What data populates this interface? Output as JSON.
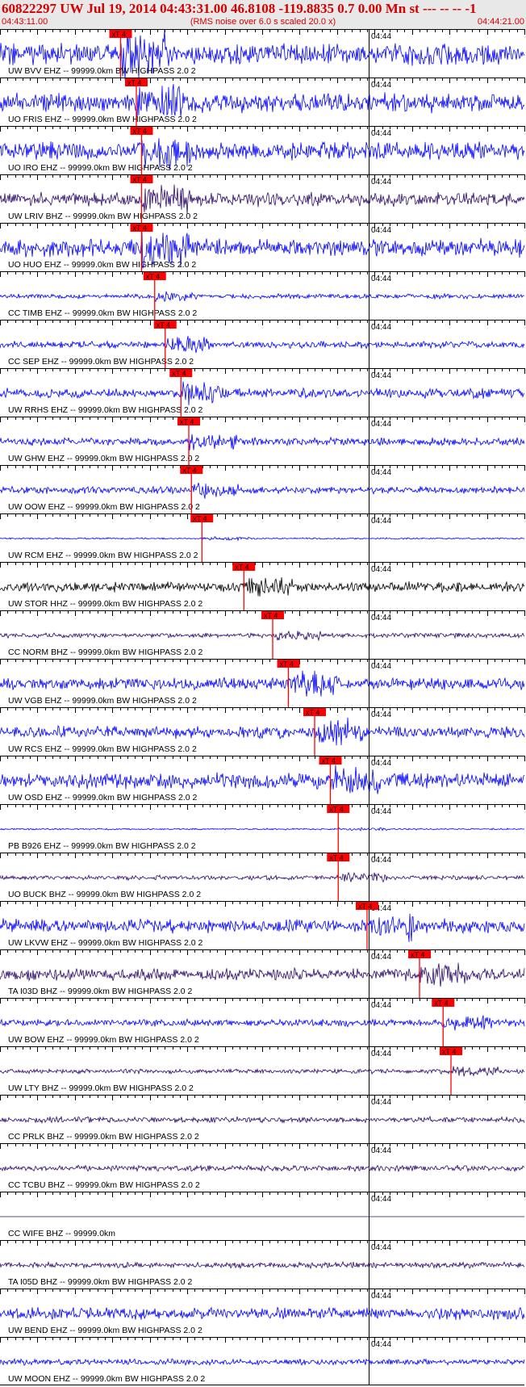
{
  "header": {
    "title": "60822297 UW Jul 19, 2014 04:43:31.00   46.8108 -119.8835  0.7 0.00 Mn st --- -- --  -1",
    "start_time": "04:43:11.00",
    "subtitle": "(RMS noise over 6.0 s scaled 20.0 x)",
    "end_time": "04:44:21.00"
  },
  "colors": {
    "trace_blue": "#0000ff",
    "trace_purple": "#2b0a6b",
    "trace_black": "#000000",
    "pick_red": "#ff0000",
    "header_bg": "#e8e8e8",
    "header_text": "#d40000"
  },
  "chart_data": {
    "type": "line",
    "x_range": [
      "04:43:11.00",
      "04:44:21.00"
    ],
    "minute_mark": "04:44",
    "pick_label": "xT 4",
    "series": [
      {
        "name": "UW BVV EHZ -- 99999.0km BW  HIGHPASS  2.0  2",
        "color": "blue",
        "amp": 0.55,
        "pick_x": 0.23
      },
      {
        "name": "UO FRIS EHZ -- 99999.0km BW  HIGHPASS  2.0  2",
        "color": "blue",
        "amp": 0.5,
        "pick_x": 0.26
      },
      {
        "name": "UO IRO EHZ -- 99999.0km BW  HIGHPASS  2.0  2",
        "color": "blue",
        "amp": 0.45,
        "pick_x": 0.27
      },
      {
        "name": "UW LRIV BHZ -- 99999.0km BW  HIGHPASS  2.0  2",
        "color": "purple",
        "amp": 0.35,
        "pick_x": 0.27
      },
      {
        "name": "UO HUO EHZ -- 99999.0km BW  HIGHPASS  2.0  2",
        "color": "blue",
        "amp": 0.45,
        "pick_x": 0.27
      },
      {
        "name": "CC TIMB EHZ -- 99999.0km BW  HIGHPASS  2.0  2",
        "color": "blue",
        "amp": 0.12,
        "pick_x": 0.295
      },
      {
        "name": "CC SEP EHZ -- 99999.0km BW  HIGHPASS  2.0  2",
        "color": "blue",
        "amp": 0.18,
        "pick_x": 0.315
      },
      {
        "name": "UW RRHS EHZ -- 99999.0km BW  HIGHPASS  2.0  2",
        "color": "blue",
        "amp": 0.25,
        "pick_x": 0.345
      },
      {
        "name": "UW GHW EHZ -- 99999.0km BW  HIGHPASS  2.0  2",
        "color": "blue",
        "amp": 0.2,
        "pick_x": 0.36
      },
      {
        "name": "UW OOW EHZ -- 99999.0km BW  HIGHPASS  2.0  2",
        "color": "blue",
        "amp": 0.18,
        "pick_x": 0.365
      },
      {
        "name": "UW RCM EHZ -- 99999.0km BW  HIGHPASS  2.0  2",
        "color": "blue",
        "amp": 0.04,
        "pick_x": 0.385
      },
      {
        "name": "UW STOR HHZ -- 99999.0km BW  HIGHPASS  2.0  2",
        "color": "black",
        "amp": 0.25,
        "pick_x": 0.465
      },
      {
        "name": "CC NORM BHZ -- 99999.0km BW  HIGHPASS  2.0  2",
        "color": "purple",
        "amp": 0.12,
        "pick_x": 0.52
      },
      {
        "name": "UW VGB EHZ -- 99999.0km BW  HIGHPASS  2.0  2",
        "color": "blue",
        "amp": 0.3,
        "pick_x": 0.55
      },
      {
        "name": "UW RCS EHZ -- 99999.0km BW  HIGHPASS  2.0  2",
        "color": "blue",
        "amp": 0.3,
        "pick_x": 0.6
      },
      {
        "name": "UW OSD EHZ -- 99999.0km BW  HIGHPASS  2.0  2",
        "color": "blue",
        "amp": 0.4,
        "pick_x": 0.63
      },
      {
        "name": "PB B926 EHZ -- 99999.0km BW  HIGHPASS  2.0  2",
        "color": "blue",
        "amp": 0.04,
        "pick_x": 0.645
      },
      {
        "name": "UO BUCK BHZ -- 99999.0km BW  HIGHPASS  2.0  2",
        "color": "purple",
        "amp": 0.12,
        "pick_x": 0.645
      },
      {
        "name": "UW LKVW EHZ -- 99999.0km BW  HIGHPASS  2.0  2",
        "color": "blue",
        "amp": 0.35,
        "pick_x": 0.7
      },
      {
        "name": "TA I03D BHZ -- 99999.0km BW  HIGHPASS  2.0  2",
        "color": "purple",
        "amp": 0.3,
        "pick_x": 0.8
      },
      {
        "name": "UW BOW EHZ -- 99999.0km BW  HIGHPASS  2.0  2",
        "color": "blue",
        "amp": 0.18,
        "pick_x": 0.845
      },
      {
        "name": "UW LTY BHZ -- 99999.0km BW  HIGHPASS  2.0  2",
        "color": "purple",
        "amp": 0.12,
        "pick_x": 0.86
      },
      {
        "name": "CC PRLK BHZ -- 99999.0km BW  HIGHPASS  2.0  2",
        "color": "purple",
        "amp": 0.15
      },
      {
        "name": "CC TCBU BHZ -- 99999.0km BW  HIGHPASS  2.0  2",
        "color": "purple",
        "amp": 0.15
      },
      {
        "name": "CC WIFE BHZ -- 99999.0km",
        "color": "purple",
        "amp": 0
      },
      {
        "name": "TA I05D BHZ -- 99999.0km BW  HIGHPASS  2.0  2",
        "color": "purple",
        "amp": 0.15
      },
      {
        "name": "UW BEND EHZ -- 99999.0km BW  HIGHPASS  2.0  2",
        "color": "blue",
        "amp": 0.3
      },
      {
        "name": "UW MOON EHZ -- 99999.0km BW  HIGHPASS  2.0  2",
        "color": "blue",
        "amp": 0.15
      }
    ]
  }
}
